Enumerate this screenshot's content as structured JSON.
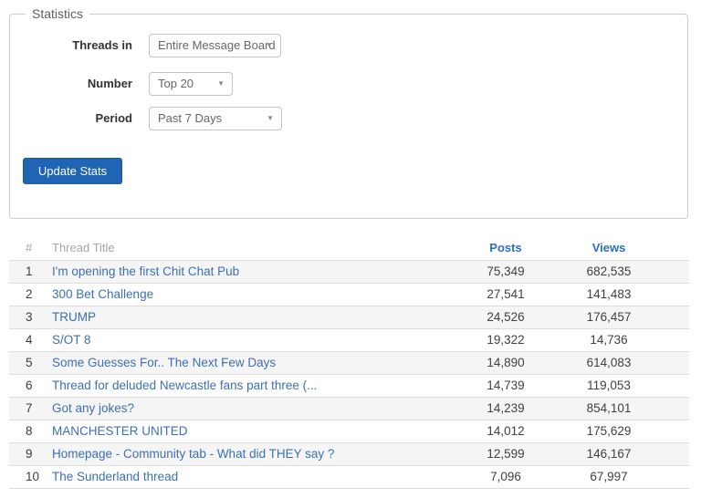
{
  "panel": {
    "legend": "Statistics",
    "fields": [
      {
        "label": "Threads in",
        "value": "Entire Message Board"
      },
      {
        "label": "Number",
        "value": "Top 20"
      },
      {
        "label": "Period",
        "value": "Past 7 Days"
      }
    ],
    "update_button": "Update Stats"
  },
  "table": {
    "headers": {
      "rank": "#",
      "title": "Thread Title",
      "posts": "Posts",
      "views": "Views"
    },
    "rows": [
      {
        "rank": "1",
        "title": "I'm opening the first Chit Chat Pub",
        "posts": "75,349",
        "views": "682,535"
      },
      {
        "rank": "2",
        "title": "300 Bet Challenge",
        "posts": "27,541",
        "views": "141,483"
      },
      {
        "rank": "3",
        "title": "TRUMP",
        "posts": "24,526",
        "views": "176,457"
      },
      {
        "rank": "4",
        "title": "S/OT 8",
        "posts": "19,322",
        "views": "14,736"
      },
      {
        "rank": "5",
        "title": "Some Guesses For.. The Next Few Days",
        "posts": "14,890",
        "views": "614,083"
      },
      {
        "rank": "6",
        "title": "Thread for deluded Newcastle fans part three (...",
        "posts": "14,739",
        "views": "119,053"
      },
      {
        "rank": "7",
        "title": "Got any jokes?",
        "posts": "14,239",
        "views": "854,101"
      },
      {
        "rank": "8",
        "title": "MANCHESTER UNITED",
        "posts": "14,012",
        "views": "175,629"
      },
      {
        "rank": "9",
        "title": "Homepage - Community tab - What did THEY say ?",
        "posts": "12,599",
        "views": "146,167"
      },
      {
        "rank": "10",
        "title": "The Sunderland thread",
        "posts": "7,096",
        "views": "67,997"
      }
    ]
  },
  "icons": {
    "dropdown_caret": "▼"
  },
  "colors": {
    "button_blue": "#2065b4",
    "header_link_blue": "#2b6cc9",
    "thread_link_blue": "#3d6fb4",
    "muted_header_gray": "#a5a5a5",
    "row_stripe": "#f5f5f5",
    "row_border": "#dddddd",
    "panel_border": "#cccccc"
  }
}
